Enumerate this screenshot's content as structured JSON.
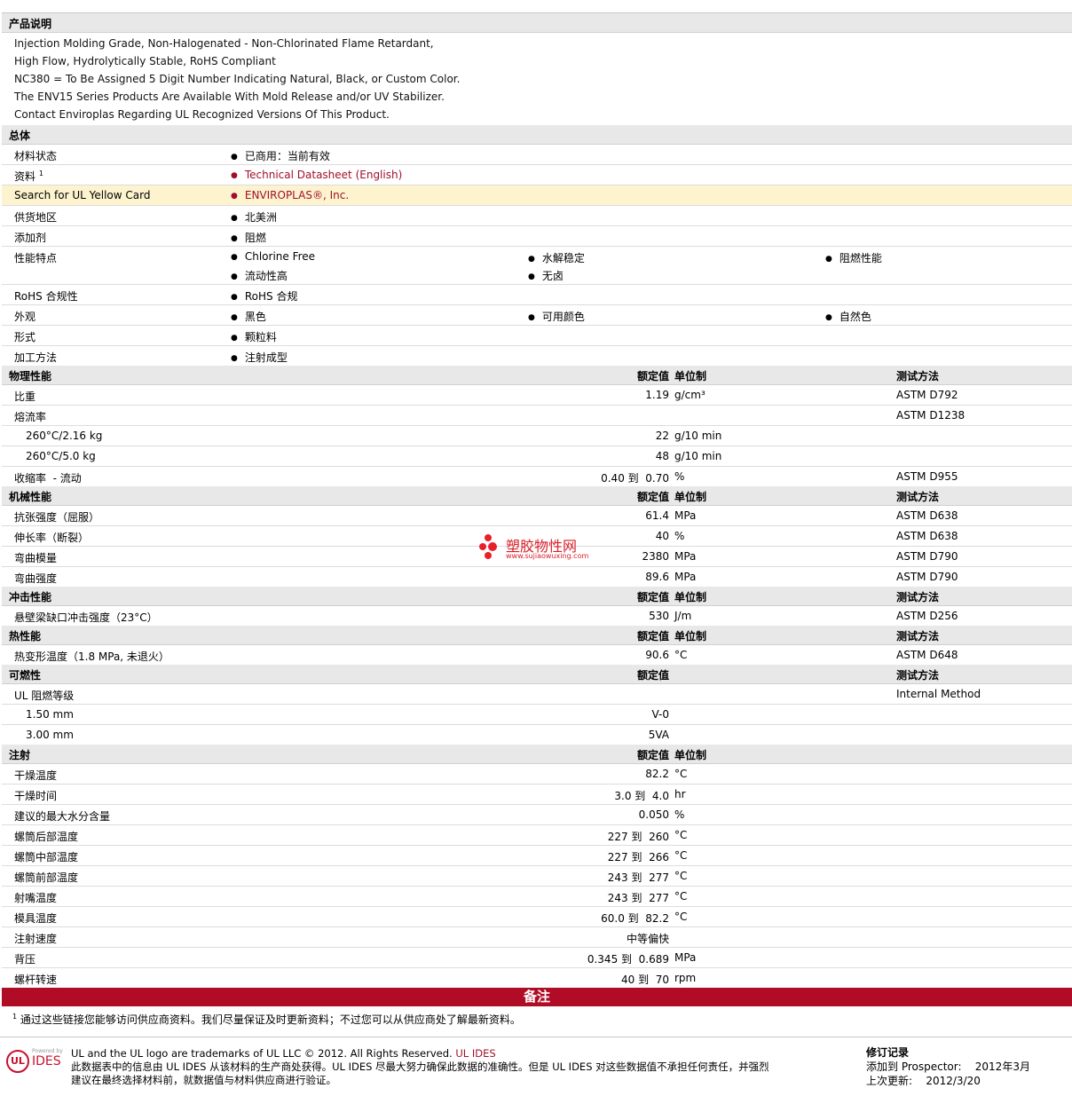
{
  "description": {
    "heading": "产品说明",
    "lines": [
      "Injection Molding Grade, Non-Halogenated - Non-Chlorinated Flame Retardant,",
      "High Flow, Hydrolytically Stable, RoHS Compliant",
      "NC380 = To Be Assigned 5 Digit Number Indicating Natural, Black, or Custom Color.",
      "The ENV15 Series Products Are Available With Mold Release and/or UV Stabilizer.",
      "Contact Enviroplas Regarding UL Recognized Versions Of This Product."
    ]
  },
  "general": {
    "heading": "总体",
    "material_status": {
      "label": "材料状态",
      "value": "已商用：当前有效"
    },
    "docs": {
      "label": "资料",
      "sup": "1",
      "value": "Technical Datasheet (English)"
    },
    "ul_card": {
      "label": "Search for UL Yellow Card",
      "value": "ENVIROPLAS®, Inc."
    },
    "region": {
      "label": "供货地区",
      "value": "北美洲"
    },
    "additive": {
      "label": "添加剂",
      "value": "阻燃"
    },
    "features": {
      "label": "性能特点",
      "v1": "Chlorine Free",
      "v2": "水解稳定",
      "v3": "阻燃性能",
      "v4": "流动性高",
      "v5": "无卤"
    },
    "rohs": {
      "label": "RoHS 合规性",
      "value": "RoHS 合规"
    },
    "appearance": {
      "label": "外观",
      "v1": "黑色",
      "v2": "可用颜色",
      "v3": "自然色"
    },
    "form": {
      "label": "形式",
      "value": "颗粒料"
    },
    "processing": {
      "label": "加工方法",
      "value": "注射成型"
    }
  },
  "headers": {
    "value": "额定值",
    "unit": "单位制",
    "method": "测试方法"
  },
  "physical": {
    "heading": "物理性能",
    "rows": [
      {
        "label": "比重",
        "value": "1.19",
        "unit": "g/cm³",
        "method": "ASTM D792"
      },
      {
        "label": "熔流率",
        "value": "",
        "unit": "",
        "method": "ASTM D1238"
      },
      {
        "label": "260°C/2.16 kg",
        "value": "22",
        "unit": "g/10 min",
        "method": ""
      },
      {
        "label": "260°C/5.0 kg",
        "value": "48",
        "unit": "g/10 min",
        "method": ""
      },
      {
        "label": "收缩率  - 流动",
        "value": "0.40 到  0.70",
        "unit": "%",
        "method": "ASTM D955"
      }
    ]
  },
  "mechanical": {
    "heading": "机械性能",
    "rows": [
      {
        "label": "抗张强度（屈服）",
        "value": "61.4",
        "unit": "MPa",
        "method": "ASTM D638"
      },
      {
        "label": "伸长率（断裂）",
        "value": "40",
        "unit": "%",
        "method": "ASTM D638"
      },
      {
        "label": "弯曲模量",
        "value": "2380",
        "unit": "MPa",
        "method": "ASTM D790"
      },
      {
        "label": "弯曲强度",
        "value": "89.6",
        "unit": "MPa",
        "method": "ASTM D790"
      }
    ]
  },
  "impact": {
    "heading": "冲击性能",
    "rows": [
      {
        "label": "悬壁梁缺口冲击强度（23°C）",
        "value": "530",
        "unit": "J/m",
        "method": "ASTM D256"
      }
    ]
  },
  "thermal": {
    "heading": "热性能",
    "rows": [
      {
        "label": "热变形温度（1.8 MPa, 未退火）",
        "value": "90.6",
        "unit": "°C",
        "method": "ASTM D648"
      }
    ]
  },
  "flammability": {
    "heading": "可燃性",
    "rows": [
      {
        "label": "UL 阻燃等级",
        "value": "",
        "method": "Internal Method"
      },
      {
        "label": "1.50 mm",
        "value": "V-0",
        "method": ""
      },
      {
        "label": "3.00 mm",
        "value": "5VA",
        "method": ""
      }
    ]
  },
  "injection": {
    "heading": "注射",
    "rows": [
      {
        "label": "干燥温度",
        "value": "82.2",
        "unit": "°C"
      },
      {
        "label": "干燥时间",
        "value": "3.0 到  4.0",
        "unit": "hr"
      },
      {
        "label": "建议的最大水分含量",
        "value": "0.050",
        "unit": "%"
      },
      {
        "label": "螺筒后部温度",
        "value": "227 到  260",
        "unit": "°C"
      },
      {
        "label": "螺筒中部温度",
        "value": "227 到  266",
        "unit": "°C"
      },
      {
        "label": "螺筒前部温度",
        "value": "243 到  277",
        "unit": "°C"
      },
      {
        "label": "射嘴温度",
        "value": "243 到  277",
        "unit": "°C"
      },
      {
        "label": "模具温度",
        "value": "60.0 到  82.2",
        "unit": "°C"
      },
      {
        "label": "注射速度",
        "value": "中等偏快",
        "unit": ""
      },
      {
        "label": "背压",
        "value": "0.345 到  0.689",
        "unit": "MPa"
      },
      {
        "label": "螺杆转速",
        "value": "40 到  70",
        "unit": "rpm"
      }
    ]
  },
  "notes": {
    "heading": "备注",
    "sup": "1",
    "text": "通过这些链接您能够访问供应商资料。我们尽量保证及时更新资料；不过您可以从供应商处了解最新资料。"
  },
  "watermark": {
    "text": "塑胶物性网",
    "sub": "www.sujiaowuxing.com"
  },
  "footer": {
    "logo_small": "Powered by",
    "logo_ul": "UL",
    "logo_ides": "IDES",
    "trademark": "UL and the UL logo are trademarks of UL LLC © 2012. All Rights Reserved.",
    "trademark_link": "UL IDES",
    "disclaimer1": "此数据表中的信息由 UL IDES 从该材料的生产商处获得。UL IDES 尽最大努力确保此数据的准确性。但是 UL IDES 对这些数据值不承担任何责任，并强烈",
    "disclaimer2": "建议在最终选择材料前，就数据值与材料供应商进行验证。",
    "rev_title": "修订记录",
    "added_label": "添加到 Prospector:",
    "added_value": "2012年3月",
    "updated_label": "上次更新:",
    "updated_value": "2012/3/20"
  }
}
